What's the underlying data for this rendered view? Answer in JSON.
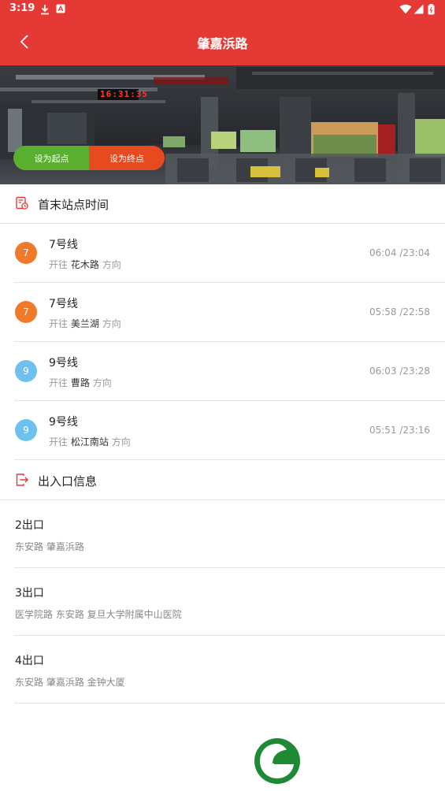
{
  "status_bar": {
    "time": "3:19"
  },
  "header": {
    "title": "肇嘉浜路"
  },
  "hero": {
    "set_start_label": "设为起点",
    "set_end_label": "设为终点",
    "clock_text": "16:31:35"
  },
  "timetable": {
    "title": "首末站点时间",
    "direction_prefix": "开往",
    "direction_suffix": "方向",
    "rows": [
      {
        "badge": "7",
        "badge_color": "#f07a2a",
        "line": "7号线",
        "station": "花木路",
        "times": "06:04 /23:04"
      },
      {
        "badge": "7",
        "badge_color": "#f07a2a",
        "line": "7号线",
        "station": "美兰湖",
        "times": "05:58 /22:58"
      },
      {
        "badge": "9",
        "badge_color": "#6ec1ee",
        "line": "9号线",
        "station": "曹路",
        "times": "06:03 /23:28"
      },
      {
        "badge": "9",
        "badge_color": "#6ec1ee",
        "line": "9号线",
        "station": "松江南站",
        "times": "05:51 /23:16"
      }
    ]
  },
  "exits": {
    "title": "出入口信息",
    "rows": [
      {
        "name": "2出口",
        "roads": "东安路 肇嘉浜路"
      },
      {
        "name": "3出口",
        "roads": "医学院路 东安路 复旦大学附属中山医院"
      },
      {
        "name": "4出口",
        "roads": "东安路 肇嘉浜路 金钟大厦"
      }
    ]
  },
  "colors": {
    "brand_red": "#e53935",
    "start_green": "#5ab02e",
    "end_orange": "#e84a1f",
    "logo_green": "#1e8a35"
  }
}
